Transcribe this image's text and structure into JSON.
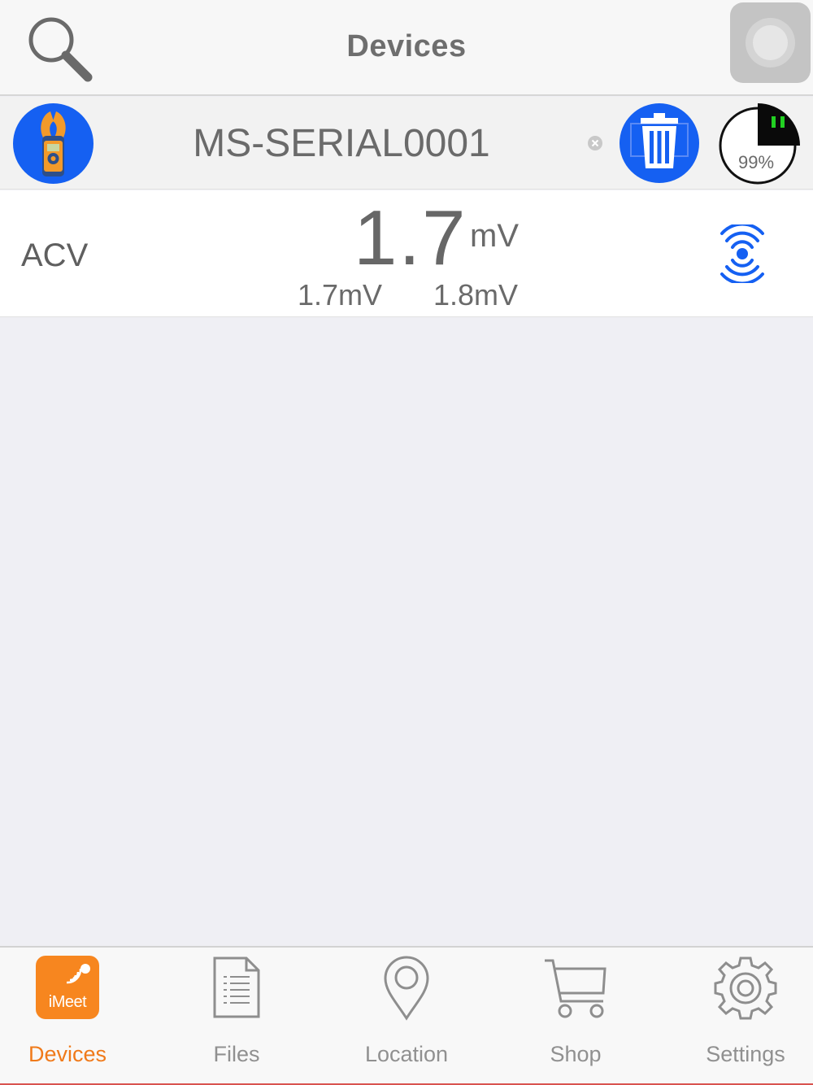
{
  "header": {
    "title": "Devices"
  },
  "device": {
    "name": "MS-SERIAL0001",
    "battery_percent": "99%"
  },
  "reading": {
    "mode": "ACV",
    "value": "1.7",
    "unit": "mV",
    "min": "1.7mV",
    "max": "1.8mV"
  },
  "tabs": [
    {
      "label": "Devices",
      "icon": "imeet-app-icon",
      "active": true,
      "icon_text": "iMeet"
    },
    {
      "label": "Files",
      "icon": "document-icon",
      "active": false
    },
    {
      "label": "Location",
      "icon": "map-pin-icon",
      "active": false
    },
    {
      "label": "Shop",
      "icon": "shopping-cart-icon",
      "active": false
    },
    {
      "label": "Settings",
      "icon": "gear-icon",
      "active": false
    }
  ],
  "colors": {
    "accent_orange": "#f07a1a",
    "device_blue": "#1560f2",
    "battery_green": "#00c000",
    "background": "#efeff4"
  }
}
